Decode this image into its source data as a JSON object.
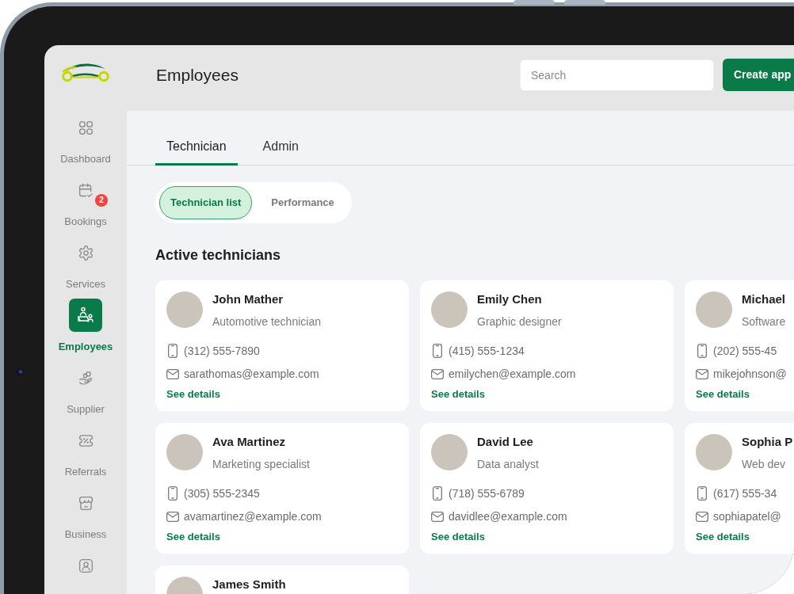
{
  "header": {
    "title": "Employees",
    "search": {
      "placeholder": "Search"
    },
    "create_button": "Create app"
  },
  "sidebar": {
    "items": [
      {
        "label": "Dashboard",
        "selected": false
      },
      {
        "label": "Bookings",
        "badge": "2",
        "selected": false
      },
      {
        "label": "Services",
        "selected": false
      },
      {
        "label": "Employees",
        "selected": true
      },
      {
        "label": "Supplier",
        "selected": false
      },
      {
        "label": "Referrals",
        "selected": false
      },
      {
        "label": "Business",
        "selected": false
      },
      {
        "selected": false
      }
    ]
  },
  "tabs": [
    {
      "label": "Technician",
      "selected": true
    },
    {
      "label": "Admin",
      "selected": false
    }
  ],
  "view_switch": [
    {
      "label": "Technician list",
      "selected": true
    },
    {
      "label": "Performance",
      "selected": false
    }
  ],
  "section_title": "Active technicians",
  "technicians": [
    {
      "name": "John Mather",
      "role": "Automotive technician",
      "phone": "(312) 555-7890",
      "email": "sarathomas@example.com",
      "link": "See details"
    },
    {
      "name": "Emily Chen",
      "role": "Graphic designer",
      "phone": "(415) 555-1234",
      "email": "emilychen@example.com",
      "link": "See details"
    },
    {
      "name": "Michael",
      "role": "Software",
      "phone": "(202) 555-45",
      "email": "mikejohnson@",
      "link": "See details"
    },
    {
      "name": "Ava Martinez",
      "role": "Marketing specialist",
      "phone": "(305) 555-2345",
      "email": "avamartinez@example.com",
      "link": "See details"
    },
    {
      "name": "David Lee",
      "role": "Data analyst",
      "phone": "(718) 555-6789",
      "email": "davidlee@example.com",
      "link": "See details"
    },
    {
      "name": "Sophia P",
      "role": "Web dev",
      "phone": "(617) 555-34",
      "email": "sophiapatel@",
      "link": "See details"
    },
    {
      "name": "James Smith"
    }
  ]
}
